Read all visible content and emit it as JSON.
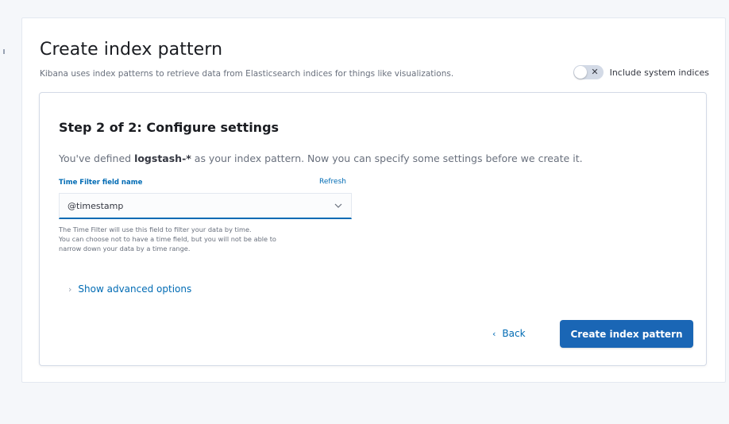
{
  "header": {
    "title": "Create index pattern",
    "subtitle": "Kibana uses index patterns to retrieve data from Elasticsearch indices for things like visualizations.",
    "system_toggle_label": "Include system indices",
    "system_toggle_on": false
  },
  "step": {
    "title": "Step 2 of 2: Configure settings",
    "desc_prefix": "You've defined ",
    "pattern": "logstash-*",
    "desc_suffix": " as your index pattern. Now you can specify some settings before we create it."
  },
  "time_field": {
    "label": "Time Filter field name",
    "refresh_label": "Refresh",
    "selected_value": "@timestamp",
    "help_lines": [
      "The Time Filter will use this field to filter your data by time.",
      "You can choose not to have a time field, but you will not be able to",
      "narrow down your data by a time range."
    ]
  },
  "advanced": {
    "label": "Show advanced options"
  },
  "actions": {
    "back_label": "Back",
    "create_label": "Create index pattern"
  },
  "colors": {
    "primary": "#006bb4",
    "button_fill": "#1a66b5",
    "text_subdued": "#69707d"
  }
}
